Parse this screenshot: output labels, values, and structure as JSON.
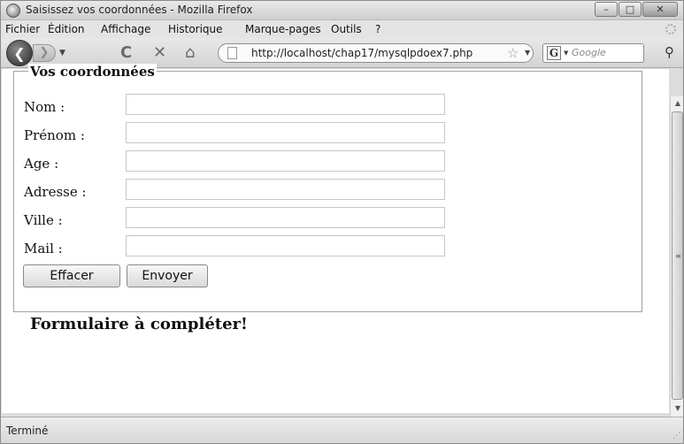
{
  "window": {
    "title": "Saisissez vos coordonnées - Mozilla Firefox",
    "controls": {
      "minimize": "–",
      "maximize": "□",
      "close": "✕"
    }
  },
  "menubar": {
    "items": [
      "Fichier",
      "Édition",
      "Affichage",
      "Historique",
      "Marque-pages",
      "Outils",
      "?"
    ]
  },
  "navbar": {
    "back_glyph": "❮",
    "forward_glyph": "❯",
    "reload_glyph": "C",
    "stop_glyph": "✕",
    "home_glyph": "⌂",
    "url": "http://localhost/chap17/mysqlpdoex7.php",
    "bookmark_glyph": "☆",
    "search_engine_glyph": "G",
    "search_placeholder": "Google",
    "search_glyph": "⚲"
  },
  "form": {
    "legend": "Vos coordonnées",
    "fields": [
      {
        "label": "Nom :",
        "value": ""
      },
      {
        "label": "Prénom :",
        "value": ""
      },
      {
        "label": "Age :",
        "value": ""
      },
      {
        "label": "Adresse :",
        "value": ""
      },
      {
        "label": "Ville :",
        "value": ""
      },
      {
        "label": "Mail :",
        "value": ""
      }
    ],
    "reset_label": "Effacer",
    "submit_label": "Envoyer"
  },
  "page": {
    "heading": "Formulaire à compléter!"
  },
  "statusbar": {
    "text": "Terminé"
  }
}
